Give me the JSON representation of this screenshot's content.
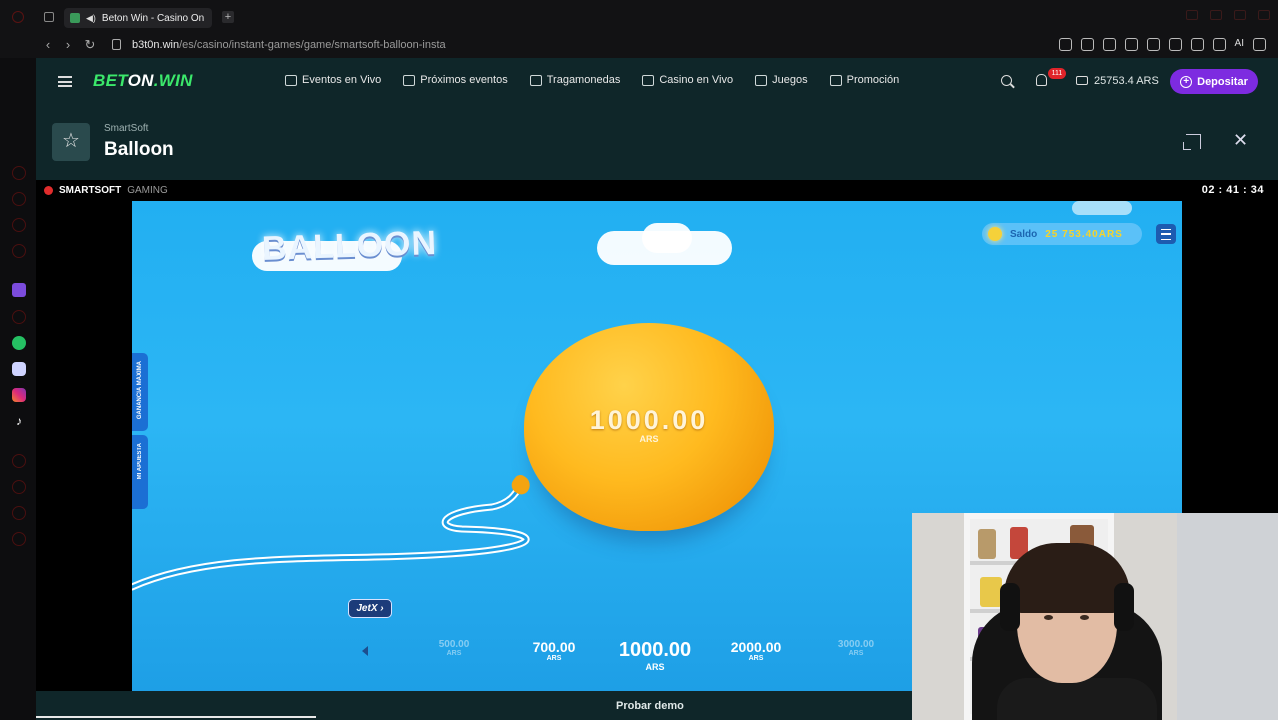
{
  "browser": {
    "tab_title": "Beton Win - Casino On",
    "url_host": "b3t0n.win",
    "url_path": "/es/casino/instant-games/game/smartsoft-balloon-insta",
    "toolbar_ai": "AI"
  },
  "site": {
    "logo_bet": "BET",
    "logo_on": "ON",
    "logo_win": ".WIN",
    "menu": [
      {
        "label": "Eventos en Vivo",
        "icon": "tv-icon"
      },
      {
        "label": "Próximos eventos",
        "icon": "calendar-icon"
      },
      {
        "label": "Tragamonedas",
        "icon": "slot-icon"
      },
      {
        "label": "Casino en Vivo",
        "icon": "chip-icon"
      },
      {
        "label": "Juegos",
        "icon": "rocket-icon"
      },
      {
        "label": "Promoción",
        "icon": "gift-icon"
      }
    ],
    "notifications": "111",
    "balance": "25753.4 ARS",
    "deposit_label": "Depositar"
  },
  "game_header": {
    "provider": "SmartSoft",
    "title": "Balloon"
  },
  "strip": {
    "brand": "SMARTSOFT",
    "brand_suffix": "GAMING",
    "clock": "02 : 41 : 34"
  },
  "game": {
    "logo": "BALLOON",
    "saldo_label": "Saldo",
    "saldo_value": "25 753.40ARS",
    "balloon_value": "1000.00",
    "balloon_currency": "ARS",
    "side_tab_1": "GANANCIA MÁXIMA",
    "side_tab_2": "MI APUESTA",
    "jetx_label": "JetX",
    "bets": [
      {
        "value": "500.00",
        "currency": "ARS"
      },
      {
        "value": "700.00",
        "currency": "ARS"
      },
      {
        "value": "1000.00",
        "currency": "ARS"
      },
      {
        "value": "2000.00",
        "currency": "ARS"
      },
      {
        "value": "3000.00",
        "currency": "ARS"
      }
    ],
    "demo_label": "Probar demo"
  },
  "colors": {
    "site_bg": "#0f2629",
    "logo_green": "#3be86b",
    "deposit_purple": "#7d2be0",
    "sky_blue": "#22aff2",
    "balloon_orange": "#ffba1f"
  }
}
